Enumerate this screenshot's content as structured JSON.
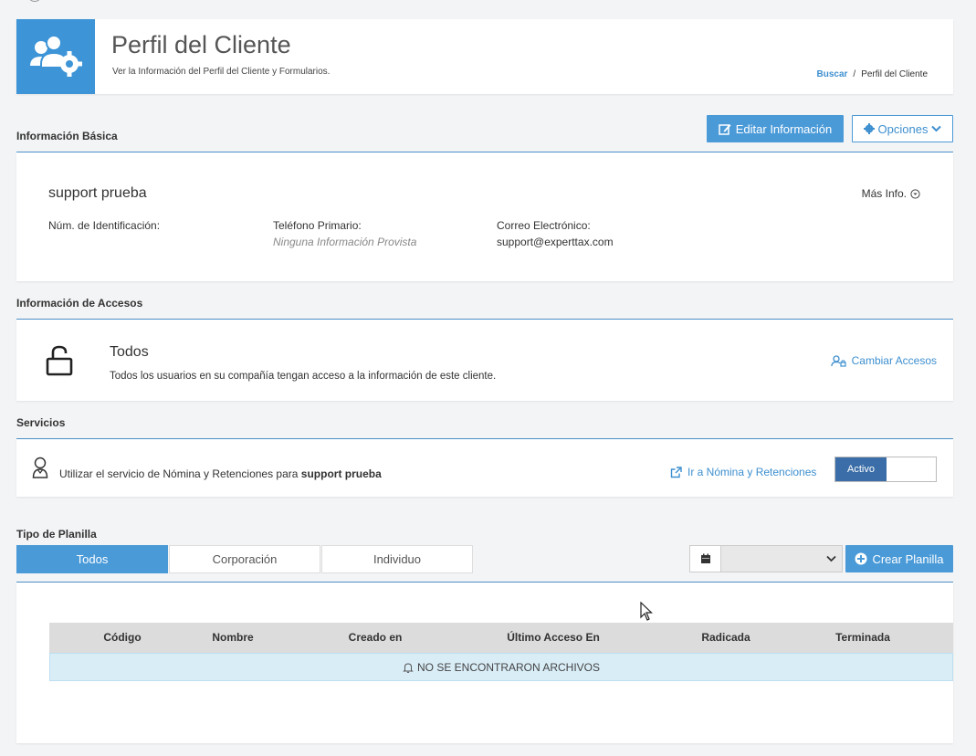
{
  "header": {
    "title": "Perfil del Cliente",
    "subtitle": "Ver la Información del Perfil del Cliente y Formularios.",
    "breadcrumb": {
      "link": "Buscar",
      "separator": "/",
      "current": "Perfil del Cliente"
    }
  },
  "basic_info": {
    "section_title": "Información Básica",
    "edit_button": "Editar Información",
    "options_button": "Opciones",
    "client_name": "support prueba",
    "more_info": "Más Info.",
    "fields": {
      "id_label": "Núm. de Identificación:",
      "id_value": "",
      "phone_label": "Teléfono Primario:",
      "phone_value": "Ninguna Información Provista",
      "email_label": "Correo Electrónico:",
      "email_value": "support@experttax.com"
    }
  },
  "access": {
    "section_title": "Información de Accesos",
    "title": "Todos",
    "description": "Todos los usuarios en su compañía tengan acceso a la información de este cliente.",
    "change_link": "Cambiar Accesos"
  },
  "services": {
    "section_title": "Servicios",
    "text_prefix": "Utilizar el servicio de Nómina y Retenciones para ",
    "text_bold": "support prueba",
    "link": "Ir a Nómina y Retenciones",
    "toggle_label": "Activo"
  },
  "forms": {
    "section_title": "Tipo de Planilla",
    "tabs": [
      "Todos",
      "Corporación",
      "Individuo"
    ],
    "date_select_value": "",
    "create_button": "Crear Planilla",
    "columns": [
      "Código",
      "Nombre",
      "Creado en",
      "Último Acceso En",
      "Radicada",
      "Terminada"
    ],
    "empty_message": "NO SE ENCONTRARON ARCHIVOS"
  },
  "colors": {
    "accent": "#4a9ad8",
    "toggle_active": "#3b6ea8",
    "empty_row": "#d9edf7"
  }
}
